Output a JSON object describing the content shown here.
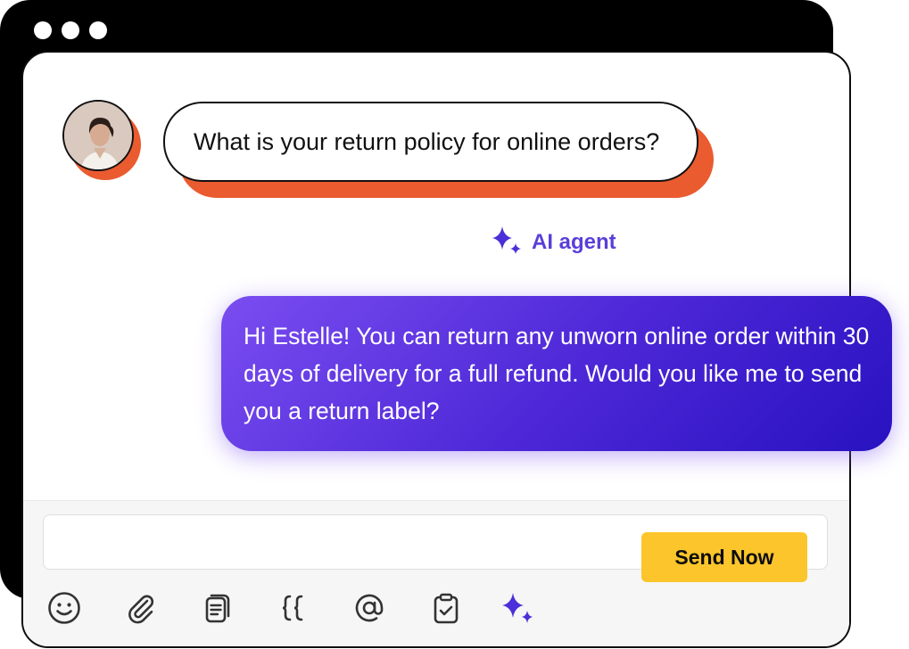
{
  "window": {
    "controls": [
      "close-dot",
      "minimize-dot",
      "maximize-dot"
    ]
  },
  "conversation": {
    "user_message": "What is your return policy for online orders?",
    "agent_label": "AI agent",
    "agent_message": "Hi Estelle! You can return any unworn online order within 30 days of delivery for a full refund. Would you like me to send you a return label?"
  },
  "composer": {
    "input_value": "",
    "input_placeholder": "",
    "send_label": "Send Now",
    "tools": [
      "emoji-icon",
      "paperclip-icon",
      "template-icon",
      "braces-icon",
      "at-icon",
      "clipboard-check-icon",
      "sparkle-icon"
    ]
  },
  "colors": {
    "window_frame": "#000000",
    "user_bubble_shadow": "#ea5b30",
    "agent_accent": "#5a3fd9",
    "agent_bubble_start": "#7a4df0",
    "agent_bubble_end": "#2812c0",
    "send_button": "#fcc52c",
    "composer_bg": "#f6f6f6"
  }
}
